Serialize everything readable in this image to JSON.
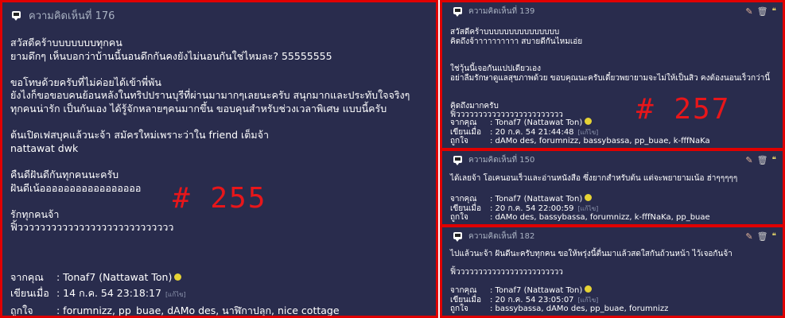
{
  "comments": [
    {
      "header": "ความคิดเห็นที่ 176",
      "body": "สวัสดีคร้าบบบบบบบทุกคน\nยามดึกๆ เห็นบอกว่าบ้านนี้นอนดึกกันคงยังไม่นอนกันใช่ไหมละ? 55555555\n\nขอโทษด้วยครับที่ไม่ค่อยได้เข้าพี่พัน\nยังไงก็ขอขอบคนย้อนหลังในทริปปรานบุรีที่ผ่านมามากๆเลยนะครับ สนุกมากและประทับใจจริงๆ\nทุกคนน่ารัก เป็นกันเอง ได้รู้จักหลายๆคนมากขึ้น ขอบคุนสำหรับช่วงเวลาพิเศษ แบบนี้ครับ\n\nต้นเปิดเฟสบุคแล้วนะจ้า สมัครใหม่เพราะว่าใน friend เต็มจ้า\nnattawat dwk\n\nคืนดีฝันดีกันทุกคนนะครับ\nฝันดีเน้อออออออออออออออออ\n\nรักทุกคนจ้า\nฟิ้วววววววววววววววววววววววววววว",
      "from_label": "จากคุณ",
      "from_value": ": Tonaf7 (Nattawat Ton)",
      "written_label": "เขียนเมื่อ",
      "written_value": ": 14 ก.ค. 54 23:18:17",
      "edit_label": "[แก้ไข]",
      "likes_label": "ถูกใจ",
      "likes_value": ": forumnizz, pp_buae, dAMo des, นาฬิกาปลุก, nice cottage",
      "annotation": "# 255"
    },
    {
      "header": "ความคิดเห็นที่ 139",
      "body": "สวัสดีคร้าบบบบบบบบบบบบบบบ\nคิดถึงจ้าาาาาาาาาา สบายดีกันไหมเอ่ย\n\n\nใช่วุ้นนี้เจอกันแปปเดียวเอง\nอย่าลืมรักษาดูแลสุขภาพด้วย ขอบคุณนะครับเดี๋ยวพยายามจะไม่ให้เป็นสิว คงต้องนอนเร็วกว่านี้\n\n\nคิดถึงมากครับ\nฟิ้วววววววววววววววววววววววว",
      "from_label": "จากคุณ",
      "from_value": ": Tonaf7 (Nattawat Ton)",
      "written_label": "เขียนเมื่อ",
      "written_value": ": 20 ก.ค. 54 21:44:48",
      "edit_label": "[แก้ไข]",
      "likes_label": "ถูกใจ",
      "likes_value": ": dAMo des, forumnizz, bassybassa, pp_buae, k-fffNaKa",
      "annotation": "# 257"
    },
    {
      "header": "ความคิดเห็นที่ 150",
      "body": "ได้เลยจ้า โอเคนอนเร็วและอ่านหนังสือ ซึ่งยากสำหรับต้น แต่จะพยายามเน้อ ฮ่าๆๆๆๆๆ",
      "from_label": "จากคุณ",
      "from_value": ": Tonaf7 (Nattawat Ton)",
      "written_label": "เขียนเมื่อ",
      "written_value": ": 20 ก.ค. 54 22:00:59",
      "edit_label": "[แก้ไข]",
      "likes_label": "ถูกใจ",
      "likes_value": ": dAMo des, bassybassa, forumnizz, k-fffNaKa, pp_buae"
    },
    {
      "header": "ความคิดเห็นที่ 182",
      "body": "ไปแล้วนะจ้า ฝันดีนะครับทุกคน ขอให้พรุ่งนี้ตื่นมาแล้วสดใสกันถ้วนหน้า ไว้เจอกันจ้า\n\nฟิ้วววววววววววววววววววววววว",
      "from_label": "จากคุณ",
      "from_value": ": Tonaf7 (Nattawat Ton)",
      "written_label": "เขียนเมื่อ",
      "written_value": ": 20 ก.ค. 54 23:05:07",
      "edit_label": "[แก้ไข]",
      "likes_label": "ถูกใจ",
      "likes_value": ": bassybassa, dAMo des, pp_buae, forumnizz"
    }
  ],
  "icons": {
    "header_icon": "comment-icon",
    "action_icons": [
      "edit-icon",
      "delete-icon",
      "quote-icon"
    ],
    "user_icon": "smiley-icon"
  },
  "colors": {
    "panel_bg": "#292c4d",
    "border": "#e00000",
    "annotation": "#e8161a",
    "header_text": "#a9b2c2"
  }
}
